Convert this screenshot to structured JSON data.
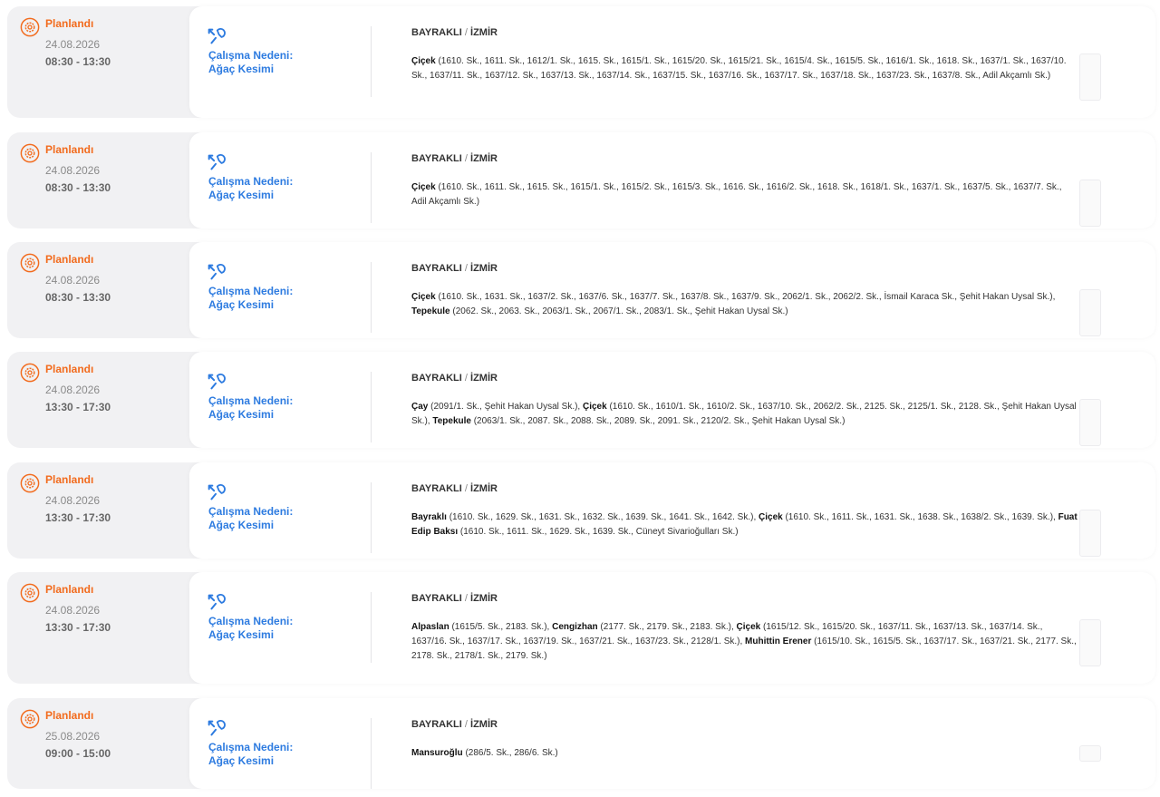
{
  "colors": {
    "status": "#f26b1d",
    "reason": "#2d7be0",
    "card_bg": "#f1f1f3",
    "panel_bg": "#ffffff"
  },
  "icons": {
    "status": "gear-icon",
    "reason": "tools-icon"
  },
  "outages": [
    {
      "status": "Planlandı",
      "date": "24.08.2026",
      "time": "08:30 - 13:30",
      "reason_title": "Çalışma Nedeni:",
      "reason": "Ağaç Kesimi",
      "district": "BAYRAKLI",
      "city": "İZMİR",
      "streets": [
        {
          "name": "Çiçek",
          "list": "(1610. Sk., 1611. Sk., 1612/1. Sk., 1615. Sk., 1615/1. Sk., 1615/20. Sk., 1615/21. Sk., 1615/4. Sk., 1615/5. Sk., 1616/1. Sk., 1618. Sk., 1637/1. Sk., 1637/10. Sk., 1637/11. Sk., 1637/12. Sk., 1637/13. Sk., 1637/14. Sk., 1637/15. Sk., 1637/16. Sk., 1637/17. Sk., 1637/18. Sk., 1637/23. Sk., 1637/8. Sk., Adil Akçamlı Sk.)"
        }
      ]
    },
    {
      "status": "Planlandı",
      "date": "24.08.2026",
      "time": "08:30 - 13:30",
      "reason_title": "Çalışma Nedeni:",
      "reason": "Ağaç Kesimi",
      "district": "BAYRAKLI",
      "city": "İZMİR",
      "streets": [
        {
          "name": "Çiçek",
          "list": "(1610. Sk., 1611. Sk., 1615. Sk., 1615/1. Sk., 1615/2. Sk., 1615/3. Sk., 1616. Sk., 1616/2. Sk., 1618. Sk., 1618/1. Sk., 1637/1. Sk., 1637/5. Sk., 1637/7. Sk., Adil Akçamlı Sk.)"
        }
      ]
    },
    {
      "status": "Planlandı",
      "date": "24.08.2026",
      "time": "08:30 - 13:30",
      "reason_title": "Çalışma Nedeni:",
      "reason": "Ağaç Kesimi",
      "district": "BAYRAKLI",
      "city": "İZMİR",
      "streets": [
        {
          "name": "Çiçek",
          "list": "(1610. Sk., 1631. Sk., 1637/2. Sk., 1637/6. Sk., 1637/7. Sk., 1637/8. Sk., 1637/9. Sk., 2062/1. Sk., 2062/2. Sk., İsmail Karaca Sk., Şehit Hakan Uysal Sk.),"
        },
        {
          "name": "Tepekule",
          "list": "(2062. Sk., 2063. Sk., 2063/1. Sk., 2067/1. Sk., 2083/1. Sk., Şehit Hakan Uysal Sk.)"
        }
      ]
    },
    {
      "status": "Planlandı",
      "date": "24.08.2026",
      "time": "13:30 - 17:30",
      "reason_title": "Çalışma Nedeni:",
      "reason": "Ağaç Kesimi",
      "district": "BAYRAKLI",
      "city": "İZMİR",
      "streets": [
        {
          "name": "Çay",
          "list": "(2091/1. Sk., Şehit Hakan Uysal Sk.),"
        },
        {
          "name": "Çiçek",
          "list": "(1610. Sk., 1610/1. Sk., 1610/2. Sk., 1637/10. Sk., 2062/2. Sk., 2125. Sk., 2125/1. Sk., 2128. Sk., Şehit Hakan Uysal Sk.),"
        },
        {
          "name": "Tepekule",
          "list": "(2063/1. Sk., 2087. Sk., 2088. Sk., 2089. Sk., 2091. Sk., 2120/2. Sk., Şehit Hakan Uysal Sk.)"
        }
      ]
    },
    {
      "status": "Planlandı",
      "date": "24.08.2026",
      "time": "13:30 - 17:30",
      "reason_title": "Çalışma Nedeni:",
      "reason": "Ağaç Kesimi",
      "district": "BAYRAKLI",
      "city": "İZMİR",
      "streets": [
        {
          "name": "Bayraklı",
          "list": "(1610. Sk., 1629. Sk., 1631. Sk., 1632. Sk., 1639. Sk., 1641. Sk., 1642. Sk.),"
        },
        {
          "name": "Çiçek",
          "list": "(1610. Sk., 1611. Sk., 1631. Sk., 1638. Sk., 1638/2. Sk., 1639. Sk.),"
        },
        {
          "name": "Fuat Edip Baksı",
          "list": "(1610. Sk., 1611. Sk., 1629. Sk., 1639. Sk., Cüneyt Sivarioğulları Sk.)"
        }
      ]
    },
    {
      "status": "Planlandı",
      "date": "24.08.2026",
      "time": "13:30 - 17:30",
      "reason_title": "Çalışma Nedeni:",
      "reason": "Ağaç Kesimi",
      "district": "BAYRAKLI",
      "city": "İZMİR",
      "streets": [
        {
          "name": "Alpaslan",
          "list": "(1615/5. Sk., 2183. Sk.),"
        },
        {
          "name": "Cengizhan",
          "list": "(2177. Sk., 2179. Sk., 2183. Sk.),"
        },
        {
          "name": "Çiçek",
          "list": "(1615/12. Sk., 1615/20. Sk., 1637/11. Sk., 1637/13. Sk., 1637/14. Sk., 1637/16. Sk., 1637/17. Sk., 1637/19. Sk., 1637/21. Sk., 1637/23. Sk., 2128/1. Sk.),"
        },
        {
          "name": "Muhittin Erener",
          "list": "(1615/10. Sk., 1615/5. Sk., 1637/17. Sk., 1637/21. Sk., 2177. Sk., 2178. Sk., 2178/1. Sk., 2179. Sk.)"
        }
      ]
    },
    {
      "status": "Planlandı",
      "date": "25.08.2026",
      "time": "09:00 - 15:00",
      "reason_title": "Çalışma Nedeni:",
      "reason": "Ağaç Kesimi",
      "district": "BAYRAKLI",
      "city": "İZMİR",
      "streets": [
        {
          "name": "Mansuroğlu",
          "list": "(286/5. Sk., 286/6. Sk.)"
        }
      ]
    }
  ]
}
